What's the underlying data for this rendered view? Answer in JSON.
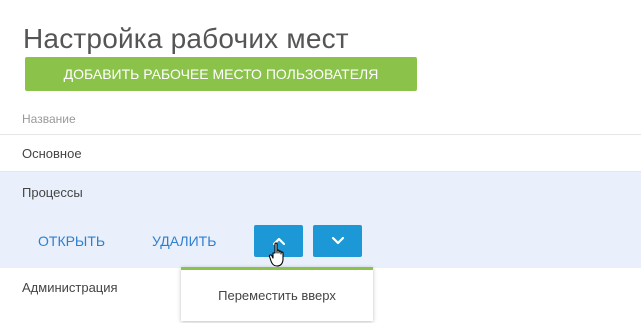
{
  "page": {
    "title": "Настройка рабочих мест",
    "add_button_label": "ДОБАВИТЬ РАБОЧЕЕ МЕСТО ПОЛЬЗОВАТЕЛЯ"
  },
  "table": {
    "column_header": "Название",
    "rows": [
      {
        "label": "Основное"
      },
      {
        "label": "Процессы",
        "selected": true
      },
      {
        "label": "Администрация"
      }
    ]
  },
  "row_actions": {
    "open_label": "ОТКРЫТЬ",
    "delete_label": "УДАЛИТЬ",
    "move_up_icon": "chevron-up-icon",
    "move_down_icon": "chevron-down-icon"
  },
  "tooltip": {
    "text": "Переместить вверх"
  },
  "colors": {
    "accent_green": "#8bc34a",
    "button_blue": "#1d98d6",
    "link_blue": "#2f7fd1",
    "selected_row": "#e9f0fb"
  }
}
